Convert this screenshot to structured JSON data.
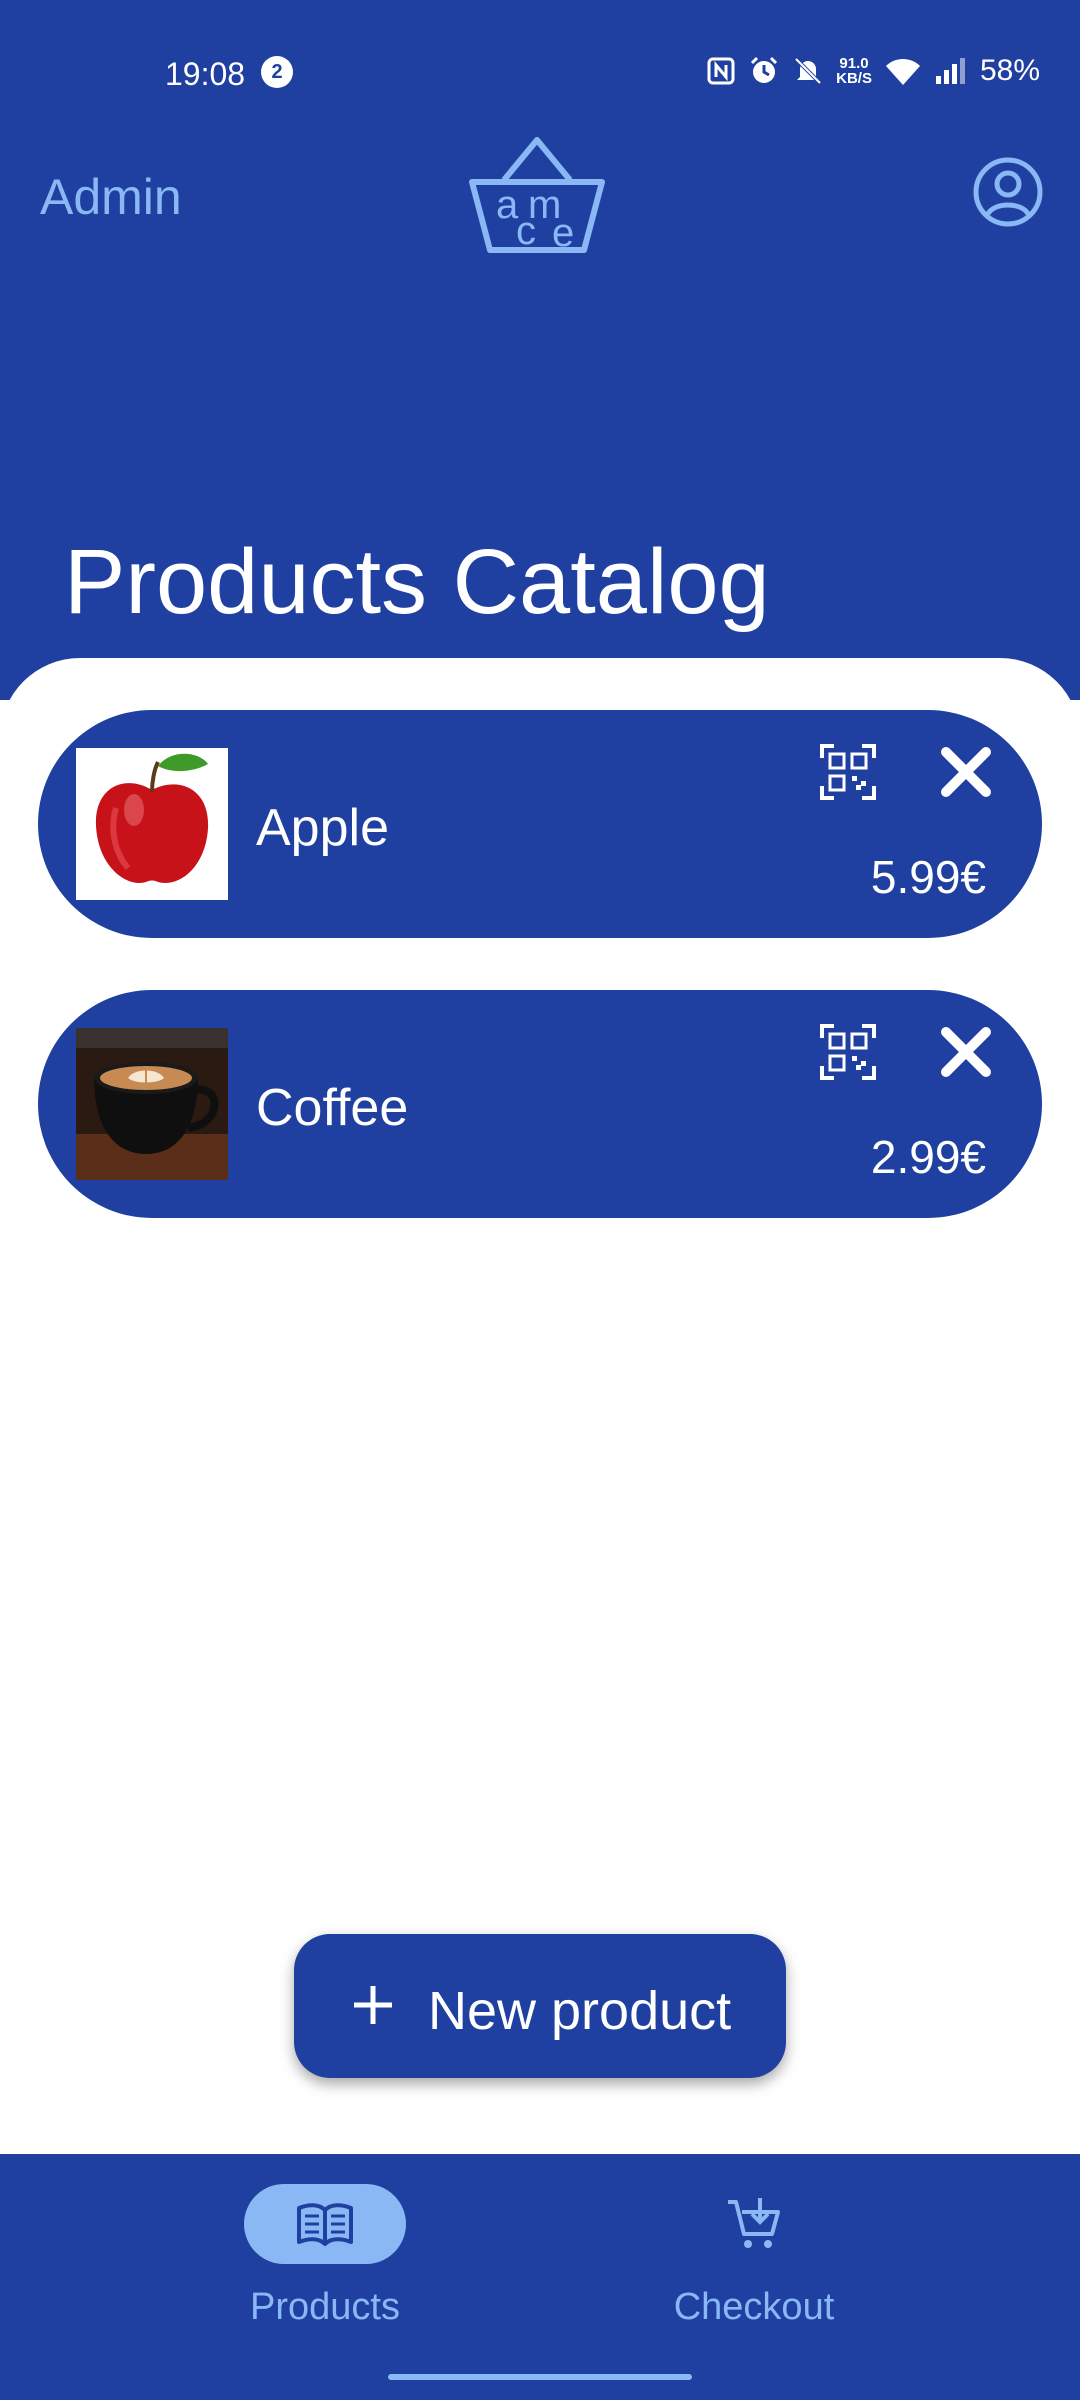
{
  "status_bar": {
    "time": "19:08",
    "notification_count": "2",
    "net_speed_value": "91.0",
    "net_speed_unit": "KB/S",
    "battery": "58%"
  },
  "header": {
    "admin_label": "Admin",
    "logo_letters": [
      "a",
      "m",
      "c",
      "e"
    ]
  },
  "page": {
    "title": "Products Catalog"
  },
  "products": [
    {
      "name": "Apple",
      "price": "5.99€",
      "image": "apple"
    },
    {
      "name": "Coffee",
      "price": "2.99€",
      "image": "coffee-cup"
    }
  ],
  "fab": {
    "label": "New product"
  },
  "nav": {
    "items": [
      {
        "label": "Products",
        "icon": "book-icon",
        "active": true
      },
      {
        "label": "Checkout",
        "icon": "cart-icon",
        "active": false
      }
    ]
  },
  "colors": {
    "primary": "#1f40a0",
    "accent": "#8ab8f4",
    "surface": "#ffffff"
  }
}
